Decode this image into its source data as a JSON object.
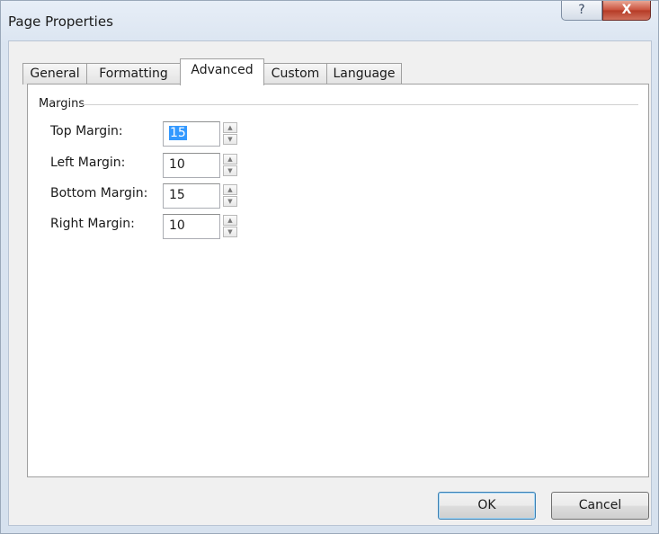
{
  "window": {
    "title": "Page Properties",
    "help_glyph": "?",
    "close_glyph": "X"
  },
  "tabs": [
    {
      "label": "General"
    },
    {
      "label": "Formatting"
    },
    {
      "label": "Advanced",
      "active": true
    },
    {
      "label": "Custom"
    },
    {
      "label": "Language"
    }
  ],
  "margins": {
    "group_title": "Margins",
    "fields": [
      {
        "label": "Top Margin:",
        "value": "15",
        "focused": true
      },
      {
        "label": "Left Margin:",
        "value": "10"
      },
      {
        "label": "Bottom Margin:",
        "value": "15"
      },
      {
        "label": "Right Margin:",
        "value": "10"
      }
    ]
  },
  "spinner": {
    "up_glyph": "▲",
    "down_glyph": "▼"
  },
  "buttons": {
    "ok": "OK",
    "cancel": "Cancel"
  }
}
